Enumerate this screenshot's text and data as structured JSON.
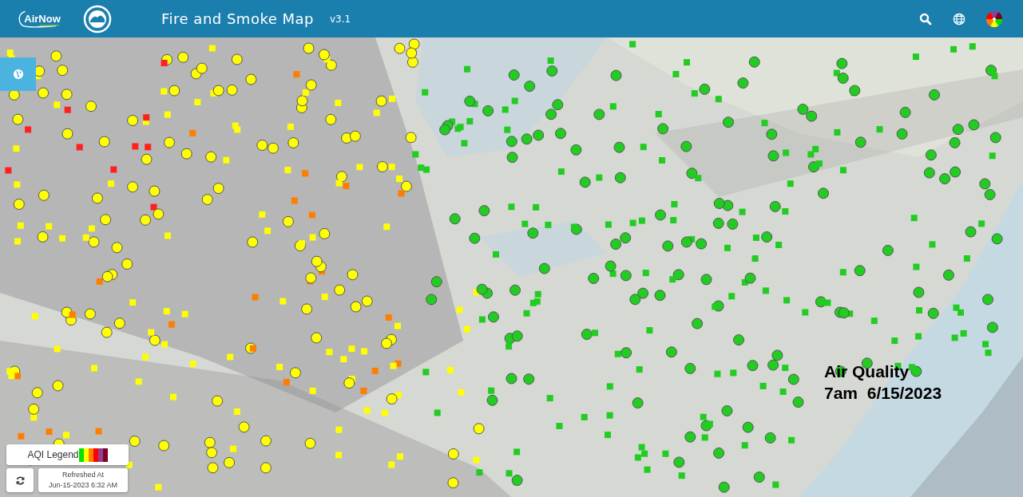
{
  "header": {
    "logo_text": "AirNow",
    "title": "Fire and Smoke Map",
    "version": "v3.1"
  },
  "map": {
    "annotation_lines": [
      "Air Quality",
      "7am  6/15/2023"
    ]
  },
  "legend": {
    "label": "AQI Legend",
    "swatches": [
      {
        "color": "#00e400"
      },
      {
        "color": "#ffff00"
      },
      {
        "color": "#ff7e00"
      },
      {
        "color": "#ff0000"
      },
      {
        "color": "#8f3f97"
      },
      {
        "color": "#7e0023"
      }
    ]
  },
  "refresh": {
    "label": "Refreshed At",
    "time": "Jun-15-2023 6:32 AM"
  }
}
